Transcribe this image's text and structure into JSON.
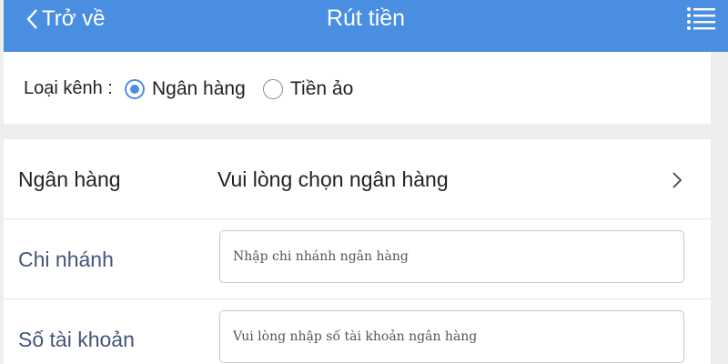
{
  "header": {
    "back_label": "Trở về",
    "title": "Rút tiền",
    "background": "#4a8ee2"
  },
  "channel": {
    "label": "Loại kênh :",
    "options": [
      {
        "label": "Ngân hàng",
        "selected": true
      },
      {
        "label": "Tiền ảo",
        "selected": false
      }
    ]
  },
  "form": {
    "bank": {
      "label": "Ngân hàng",
      "value": "Vui lòng chọn ngân hàng"
    },
    "branch": {
      "label": "Chi nhánh",
      "placeholder": "Nhập chi nhánh ngân hàng"
    },
    "account": {
      "label": "Số tài khoản",
      "placeholder": "Vui lòng nhập số tài khoản ngân hàng"
    }
  },
  "icons": [
    "chevron-left-icon",
    "list-menu-icon",
    "chevron-right-icon"
  ]
}
